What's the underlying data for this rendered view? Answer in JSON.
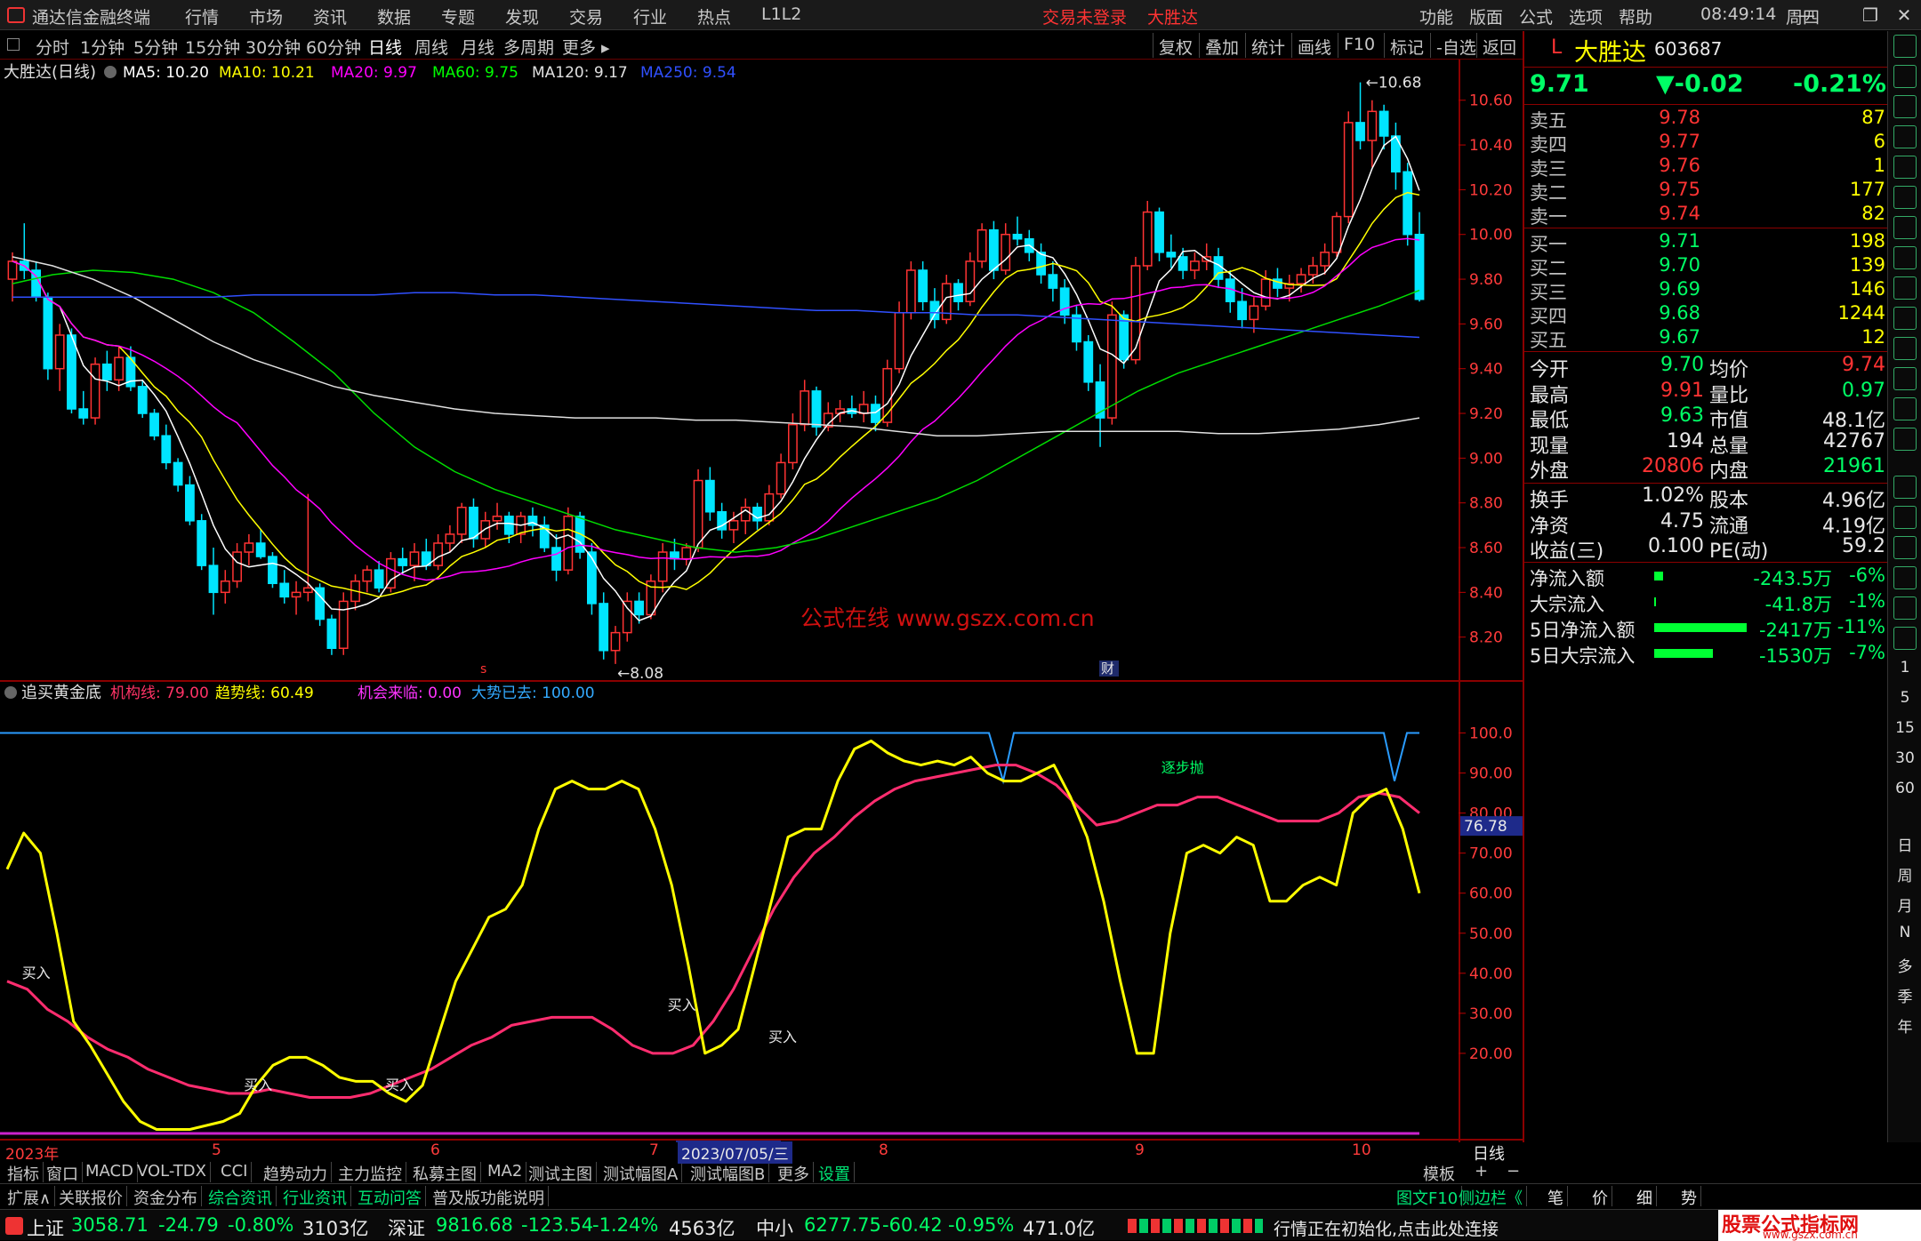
{
  "titlebar": {
    "app_name": "通达信金融终端",
    "menu": [
      "行情",
      "市场",
      "资讯",
      "数据",
      "专题",
      "发现",
      "交易",
      "行业",
      "热点",
      "L1L2"
    ],
    "login_status": "交易未登录",
    "stock_name": "大胜达",
    "right_menu": [
      "功能",
      "版面",
      "公式",
      "选项",
      "帮助"
    ],
    "time": "08:49:14",
    "weekday": "周四"
  },
  "periods": {
    "items": [
      "分时",
      "1分钟",
      "5分钟",
      "15分钟",
      "30分钟",
      "60分钟",
      "日线",
      "周线",
      "月线",
      "多周期",
      "更多"
    ],
    "selected": "日线",
    "right_buttons": [
      "复权",
      "叠加",
      "统计",
      "画线",
      "F10",
      "标记",
      "-自选",
      "返回"
    ]
  },
  "main_chart": {
    "title": "大胜达(日线)",
    "ma": [
      {
        "label": "MA5: 10.20",
        "color": "#ffffff"
      },
      {
        "label": "MA10: 10.21",
        "color": "#ffff00"
      },
      {
        "label": "MA20: 9.97",
        "color": "#ff00ff"
      },
      {
        "label": "MA60: 9.75",
        "color": "#00ff00"
      },
      {
        "label": "MA120: 9.17",
        "color": "#e0e0e0"
      },
      {
        "label": "MA250: 9.54",
        "color": "#3050ff"
      }
    ],
    "y_ticks": [
      "10.60",
      "10.40",
      "10.20",
      "10.00",
      "9.80",
      "9.60",
      "9.40",
      "9.20",
      "9.00",
      "8.80",
      "8.60",
      "8.40",
      "8.20"
    ],
    "high_label": "10.68",
    "low_label": "8.08",
    "watermark": "公式在线 www.gszx.com.cn",
    "marker_s": "s",
    "marker_cai": "财"
  },
  "chart_data": {
    "type": "candlestick",
    "ylim": [
      8.0,
      10.75
    ],
    "candles": [
      [
        9.8,
        9.92,
        9.7,
        9.88
      ],
      [
        9.88,
        10.05,
        9.8,
        9.84
      ],
      [
        9.84,
        9.88,
        9.7,
        9.72
      ],
      [
        9.72,
        9.74,
        9.35,
        9.4
      ],
      [
        9.4,
        9.6,
        9.3,
        9.55
      ],
      [
        9.55,
        9.58,
        9.2,
        9.22
      ],
      [
        9.22,
        9.3,
        9.15,
        9.18
      ],
      [
        9.18,
        9.45,
        9.15,
        9.42
      ],
      [
        9.42,
        9.48,
        9.3,
        9.35
      ],
      [
        9.35,
        9.5,
        9.3,
        9.45
      ],
      [
        9.45,
        9.5,
        9.3,
        9.32
      ],
      [
        9.32,
        9.35,
        9.18,
        9.2
      ],
      [
        9.2,
        9.22,
        9.08,
        9.1
      ],
      [
        9.1,
        9.15,
        8.95,
        8.98
      ],
      [
        8.98,
        9.0,
        8.85,
        8.88
      ],
      [
        8.88,
        8.92,
        8.7,
        8.72
      ],
      [
        8.72,
        8.75,
        8.5,
        8.52
      ],
      [
        8.52,
        8.6,
        8.3,
        8.4
      ],
      [
        8.4,
        8.5,
        8.35,
        8.45
      ],
      [
        8.45,
        8.62,
        8.42,
        8.58
      ],
      [
        8.58,
        8.66,
        8.52,
        8.62
      ],
      [
        8.62,
        8.68,
        8.55,
        8.56
      ],
      [
        8.56,
        8.58,
        8.42,
        8.44
      ],
      [
        8.44,
        8.5,
        8.35,
        8.38
      ],
      [
        8.38,
        8.45,
        8.3,
        8.4
      ],
      [
        8.4,
        8.84,
        8.36,
        8.42
      ],
      [
        8.42,
        8.44,
        8.25,
        8.28
      ],
      [
        8.28,
        8.3,
        8.12,
        8.15
      ],
      [
        8.15,
        8.4,
        8.12,
        8.36
      ],
      [
        8.36,
        8.48,
        8.32,
        8.45
      ],
      [
        8.45,
        8.52,
        8.4,
        8.5
      ],
      [
        8.5,
        8.54,
        8.4,
        8.42
      ],
      [
        8.42,
        8.58,
        8.4,
        8.55
      ],
      [
        8.55,
        8.6,
        8.48,
        8.52
      ],
      [
        8.52,
        8.62,
        8.45,
        8.58
      ],
      [
        8.58,
        8.64,
        8.5,
        8.52
      ],
      [
        8.52,
        8.66,
        8.5,
        8.62
      ],
      [
        8.62,
        8.7,
        8.58,
        8.66
      ],
      [
        8.66,
        8.8,
        8.62,
        8.78
      ],
      [
        8.78,
        8.82,
        8.6,
        8.64
      ],
      [
        8.64,
        8.76,
        8.6,
        8.72
      ],
      [
        8.72,
        8.8,
        8.68,
        8.74
      ],
      [
        8.74,
        8.76,
        8.62,
        8.66
      ],
      [
        8.66,
        8.76,
        8.62,
        8.74
      ],
      [
        8.74,
        8.78,
        8.65,
        8.7
      ],
      [
        8.7,
        8.74,
        8.58,
        8.6
      ],
      [
        8.6,
        8.66,
        8.45,
        8.5
      ],
      [
        8.5,
        8.78,
        8.48,
        8.74
      ],
      [
        8.74,
        8.76,
        8.55,
        8.58
      ],
      [
        8.58,
        8.62,
        8.3,
        8.35
      ],
      [
        8.35,
        8.4,
        8.1,
        8.14
      ],
      [
        8.14,
        8.25,
        8.08,
        8.22
      ],
      [
        8.22,
        8.4,
        8.18,
        8.36
      ],
      [
        8.36,
        8.4,
        8.26,
        8.3
      ],
      [
        8.3,
        8.48,
        8.28,
        8.45
      ],
      [
        8.45,
        8.62,
        8.4,
        8.58
      ],
      [
        8.58,
        8.64,
        8.5,
        8.55
      ],
      [
        8.55,
        8.62,
        8.52,
        8.6
      ],
      [
        8.6,
        8.95,
        8.58,
        8.9
      ],
      [
        8.9,
        8.96,
        8.72,
        8.76
      ],
      [
        8.76,
        8.8,
        8.64,
        8.68
      ],
      [
        8.68,
        8.76,
        8.62,
        8.72
      ],
      [
        8.72,
        8.82,
        8.66,
        8.78
      ],
      [
        8.78,
        8.8,
        8.68,
        8.72
      ],
      [
        8.72,
        8.88,
        8.7,
        8.84
      ],
      [
        8.84,
        9.02,
        8.82,
        8.98
      ],
      [
        8.98,
        9.2,
        8.95,
        9.15
      ],
      [
        9.15,
        9.35,
        9.12,
        9.3
      ],
      [
        9.3,
        9.32,
        9.1,
        9.14
      ],
      [
        9.14,
        9.25,
        9.12,
        9.2
      ],
      [
        9.2,
        9.26,
        9.16,
        9.22
      ],
      [
        9.22,
        9.28,
        9.18,
        9.2
      ],
      [
        9.2,
        9.3,
        9.16,
        9.24
      ],
      [
        9.24,
        9.28,
        9.12,
        9.16
      ],
      [
        9.16,
        9.44,
        9.14,
        9.4
      ],
      [
        9.4,
        9.7,
        9.38,
        9.65
      ],
      [
        9.65,
        9.88,
        9.62,
        9.84
      ],
      [
        9.84,
        9.88,
        9.66,
        9.7
      ],
      [
        9.7,
        9.76,
        9.58,
        9.62
      ],
      [
        9.62,
        9.82,
        9.6,
        9.78
      ],
      [
        9.78,
        9.8,
        9.66,
        9.7
      ],
      [
        9.7,
        9.92,
        9.68,
        9.88
      ],
      [
        9.88,
        10.05,
        9.85,
        10.02
      ],
      [
        10.02,
        10.06,
        9.8,
        9.84
      ],
      [
        9.84,
        10.05,
        9.82,
        10.0
      ],
      [
        10.0,
        10.08,
        9.95,
        9.98
      ],
      [
        9.98,
        10.02,
        9.88,
        9.92
      ],
      [
        9.92,
        9.96,
        9.78,
        9.82
      ],
      [
        9.82,
        9.88,
        9.7,
        9.76
      ],
      [
        9.76,
        9.8,
        9.6,
        9.64
      ],
      [
        9.64,
        9.68,
        9.48,
        9.52
      ],
      [
        9.52,
        9.55,
        9.3,
        9.34
      ],
      [
        9.34,
        9.42,
        9.05,
        9.18
      ],
      [
        9.18,
        9.7,
        9.15,
        9.64
      ],
      [
        9.64,
        9.66,
        9.4,
        9.44
      ],
      [
        9.44,
        9.9,
        9.42,
        9.86
      ],
      [
        9.86,
        10.15,
        9.84,
        10.1
      ],
      [
        10.1,
        10.12,
        9.88,
        9.92
      ],
      [
        9.92,
        10.0,
        9.85,
        9.9
      ],
      [
        9.9,
        9.94,
        9.8,
        9.84
      ],
      [
        9.84,
        9.92,
        9.8,
        9.88
      ],
      [
        9.88,
        9.96,
        9.84,
        9.9
      ],
      [
        9.9,
        9.94,
        9.76,
        9.8
      ],
      [
        9.8,
        9.84,
        9.65,
        9.7
      ],
      [
        9.7,
        9.76,
        9.58,
        9.62
      ],
      [
        9.62,
        9.72,
        9.56,
        9.68
      ],
      [
        9.68,
        9.84,
        9.66,
        9.8
      ],
      [
        9.8,
        9.85,
        9.72,
        9.76
      ],
      [
        9.76,
        9.82,
        9.7,
        9.78
      ],
      [
        9.78,
        9.85,
        9.74,
        9.82
      ],
      [
        9.82,
        9.9,
        9.78,
        9.86
      ],
      [
        9.86,
        9.96,
        9.82,
        9.92
      ],
      [
        9.92,
        10.1,
        9.9,
        10.08
      ],
      [
        10.08,
        10.55,
        10.05,
        10.5
      ],
      [
        10.5,
        10.68,
        10.38,
        10.42
      ],
      [
        10.42,
        10.6,
        10.3,
        10.55
      ],
      [
        10.55,
        10.58,
        10.38,
        10.44
      ],
      [
        10.44,
        10.5,
        10.2,
        10.28
      ],
      [
        10.28,
        10.32,
        9.95,
        10.0
      ],
      [
        10.0,
        10.1,
        9.7,
        9.71
      ]
    ],
    "y2lim": [
      0,
      105
    ],
    "y2_ticks": [
      "100.0",
      "90.00",
      "80.00",
      "70.00",
      "60.00",
      "50.00",
      "40.00",
      "30.00",
      "20.00"
    ],
    "yellow_line": [
      66,
      75,
      70,
      50,
      28,
      22,
      15,
      8,
      3,
      1,
      1,
      1,
      2,
      3,
      5,
      12,
      17,
      19,
      19,
      17,
      14,
      13,
      13,
      10,
      8,
      12,
      25,
      38,
      46,
      54,
      56,
      62,
      76,
      86,
      88,
      86,
      86,
      88,
      86,
      76,
      62,
      42,
      20,
      22,
      26,
      42,
      58,
      74,
      76,
      76,
      88,
      96,
      98,
      95,
      93,
      92,
      93,
      92,
      94,
      90,
      88,
      88,
      90,
      92,
      84,
      74,
      58,
      38,
      20,
      20,
      50,
      70,
      72,
      70,
      74,
      72,
      58,
      58,
      62,
      64,
      62,
      80,
      84,
      86,
      76,
      60
    ],
    "pink_line": [
      38,
      36,
      31,
      28,
      24,
      21,
      19,
      16,
      14,
      12,
      11,
      10,
      10,
      11,
      10,
      9,
      9,
      9,
      10,
      12,
      14,
      16,
      19,
      22,
      24,
      27,
      28,
      29,
      29,
      29,
      26,
      22,
      20,
      20,
      22,
      28,
      36,
      46,
      56,
      64,
      70,
      74,
      79,
      83,
      86,
      88,
      89,
      90,
      91,
      92,
      92,
      90,
      87,
      82,
      77,
      78,
      80,
      82,
      82,
      84,
      84,
      82,
      80,
      78,
      78,
      78,
      80,
      84,
      85,
      84,
      80
    ],
    "buy_points": [
      [
        1,
        38
      ],
      [
        12,
        10
      ],
      [
        19,
        10
      ],
      [
        33,
        30
      ],
      [
        38,
        22
      ]
    ],
    "sell_label_point": [
      58,
      91
    ]
  },
  "indicator": {
    "title": "追买黄金底",
    "items": [
      {
        "label": "机构线: 79.00",
        "color": "#ff3366"
      },
      {
        "label": "趋势线: 60.49",
        "color": "#ffff00"
      },
      {
        "label": "机会来临: 0.00",
        "color": "#ff33ff"
      },
      {
        "label": "大势已去: 100.00",
        "color": "#33aaff"
      }
    ],
    "current_value": "76.78",
    "buy_label": "买入",
    "sell_label": "逐步抛"
  },
  "xaxis": {
    "labels": [
      "2023年",
      "5",
      "6",
      "7",
      "2023/07/05/三",
      "8",
      "9",
      "10"
    ],
    "right_label": "日线"
  },
  "quote": {
    "badge": "L",
    "name": "大胜达",
    "code": "603687",
    "price": "9.71",
    "change": "▼-0.02",
    "pct": "-0.21%",
    "asks": [
      {
        "label": "卖五",
        "price": "9.78",
        "vol": "87"
      },
      {
        "label": "卖四",
        "price": "9.77",
        "vol": "6"
      },
      {
        "label": "卖三",
        "price": "9.76",
        "vol": "1"
      },
      {
        "label": "卖二",
        "price": "9.75",
        "vol": "177"
      },
      {
        "label": "卖一",
        "price": "9.74",
        "vol": "82"
      }
    ],
    "bids": [
      {
        "label": "买一",
        "price": "9.71",
        "vol": "198"
      },
      {
        "label": "买二",
        "price": "9.70",
        "vol": "139"
      },
      {
        "label": "买三",
        "price": "9.69",
        "vol": "146"
      },
      {
        "label": "买四",
        "price": "9.68",
        "vol": "1244"
      },
      {
        "label": "买五",
        "price": "9.67",
        "vol": "12"
      }
    ],
    "stats": [
      {
        "l1": "今开",
        "v1": "9.70",
        "c1": "#00ff66",
        "l2": "均价",
        "v2": "9.74",
        "c2": "#ff3333"
      },
      {
        "l1": "最高",
        "v1": "9.91",
        "c1": "#ff3333",
        "l2": "量比",
        "v2": "0.97",
        "c2": "#00ff66"
      },
      {
        "l1": "最低",
        "v1": "9.63",
        "c1": "#00ff66",
        "l2": "市值",
        "v2": "48.1亿",
        "c2": "#e8e8e8"
      },
      {
        "l1": "现量",
        "v1": "194",
        "c1": "#e8e8e8",
        "l2": "总量",
        "v2": "42767",
        "c2": "#e8e8e8"
      },
      {
        "l1": "外盘",
        "v1": "20806",
        "c1": "#ff3333",
        "l2": "内盘",
        "v2": "21961",
        "c2": "#00ff66"
      }
    ],
    "stats2": [
      {
        "l1": "换手",
        "v1": "1.02%",
        "l2": "股本",
        "v2": "4.96亿"
      },
      {
        "l1": "净资",
        "v1": "4.75",
        "l2": "流通",
        "v2": "4.19亿"
      },
      {
        "l1": "收益(三)",
        "v1": "0.100",
        "l2": "PE(动)",
        "v2": "59.2"
      }
    ],
    "flows": [
      {
        "label": "净流入额",
        "val": "-243.5万",
        "pct": "-6%",
        "bar": 0.1
      },
      {
        "label": "大宗流入",
        "val": "-41.8万",
        "pct": "-1%",
        "bar": 0.02
      },
      {
        "label": "5日净流入额",
        "val": "-2417万",
        "pct": "-11%",
        "bar": 1.0
      },
      {
        "label": "5日大宗流入",
        "val": "-1530万",
        "pct": "-7%",
        "bar": 0.63
      }
    ]
  },
  "tabs_row1": [
    "指标",
    "窗口",
    "MACD",
    "VOL-TDX",
    "CCI",
    "趋势动力",
    "主力监控",
    "私募主图",
    "MA2",
    "测试主图",
    "测试幅图A",
    "测试幅图B",
    "更多",
    "设置"
  ],
  "tabs_row1_right": [
    "模板",
    "+",
    "−"
  ],
  "tabs_row2": [
    "扩展∧",
    "关联报价",
    "资金分布",
    "综合资讯",
    "行业资讯",
    "互动问答",
    "普及版功能说明"
  ],
  "tabs_row2_right": [
    "图文F10",
    "侧边栏《",
    "笔",
    "价",
    "细",
    "势"
  ],
  "status": {
    "sh_label": "上证",
    "sh_val": "3058.71",
    "sh_chg": "-24.79",
    "sh_pct": "-0.80%",
    "sh_amt": "3103亿",
    "sz_label": "深证",
    "sz_val": "9816.68",
    "sz_chg": "-123.54",
    "sz_pct": "-1.24%",
    "sz_amt": "4563亿",
    "zx_label": "中小",
    "zx_val": "6277.75",
    "zx_chg": "-60.42",
    "zx_pct": "-0.95%",
    "zx_amt": "471.0亿",
    "msg": "行情正在初始化,点击此处连接",
    "brand": "股票公式指标网",
    "brand_url": "www.gszx.com.cn"
  },
  "iconcol_labels": [
    "1",
    "5",
    "15",
    "30",
    "60",
    "日",
    "周",
    "月",
    "N",
    "多",
    "季",
    "年"
  ]
}
